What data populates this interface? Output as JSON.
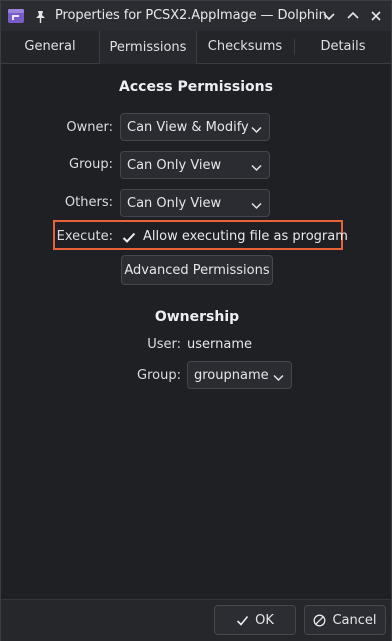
{
  "window": {
    "title": "Properties for PCSX2.AppImage — Dolphin",
    "icons": {
      "app": "dolphin-app-icon",
      "pin": "pin-icon",
      "minimize": "chevron-down-icon",
      "maximize": "chevron-up-icon",
      "close": "close-icon"
    }
  },
  "tabs": [
    {
      "label": "General",
      "active": false
    },
    {
      "label": "Permissions",
      "active": true
    },
    {
      "label": "Checksums",
      "active": false
    },
    {
      "label": "Details",
      "active": false
    }
  ],
  "access_permissions": {
    "heading": "Access Permissions",
    "owner": {
      "label": "Owner:",
      "value": "Can View & Modify"
    },
    "group": {
      "label": "Group:",
      "value": "Can Only View"
    },
    "others": {
      "label": "Others:",
      "value": "Can Only View"
    },
    "execute": {
      "label": "Execute:",
      "checkbox_label": "Allow executing file as program",
      "checked": true,
      "highlight_color": "#e8623a"
    },
    "advanced_button": "Advanced Permissions"
  },
  "ownership": {
    "heading": "Ownership",
    "user_label": "User:",
    "user_value": "username",
    "group_label": "Group:",
    "group_value": "groupname"
  },
  "footer": {
    "ok_label": "OK",
    "cancel_label": "Cancel",
    "ok_icon": "checkmark-icon",
    "cancel_icon": "cancel-icon"
  }
}
